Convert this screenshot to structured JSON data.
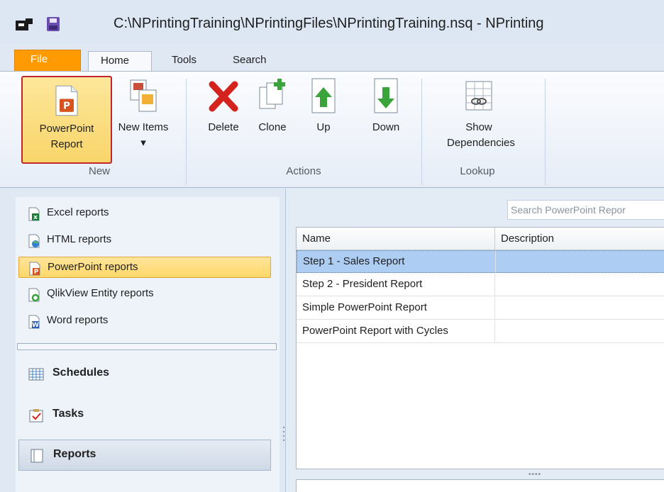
{
  "window": {
    "title": "C:\\NPrintingTraining\\NPrintingFiles\\NPrintingTraining.nsq - NPrinting"
  },
  "ribbon_tabs": [
    {
      "label": "File"
    },
    {
      "label": "Home"
    },
    {
      "label": "Tools"
    },
    {
      "label": "Search"
    }
  ],
  "ribbon": {
    "powerpoint_report": "PowerPoint Report",
    "new_items": "New Items ▾",
    "delete": "Delete",
    "clone": "Clone",
    "up": "Up",
    "down": "Down",
    "show_dependencies": "Show Dependencies",
    "groups": {
      "new": "New",
      "actions": "Actions",
      "lookup": "Lookup"
    }
  },
  "nav": {
    "reports": [
      {
        "label": "Excel reports",
        "icon": "excel-icon"
      },
      {
        "label": "HTML reports",
        "icon": "html-icon"
      },
      {
        "label": "PowerPoint reports",
        "icon": "powerpoint-icon",
        "selected": true
      },
      {
        "label": "QlikView Entity reports",
        "icon": "qlikview-icon"
      },
      {
        "label": "Word reports",
        "icon": "word-icon"
      }
    ],
    "sections": [
      {
        "label": "Schedules",
        "icon": "schedules-icon"
      },
      {
        "label": "Tasks",
        "icon": "tasks-icon"
      },
      {
        "label": "Reports",
        "icon": "reports-icon",
        "active": true
      }
    ]
  },
  "main": {
    "search_placeholder": "Search PowerPoint Repor",
    "columns": [
      "Name",
      "Description"
    ],
    "rows": [
      {
        "name": "Step 1 - Sales Report",
        "description": "",
        "selected": true
      },
      {
        "name": "Step 2 - President Report",
        "description": ""
      },
      {
        "name": "Simple PowerPoint Report",
        "description": ""
      },
      {
        "name": "PowerPoint Report with Cycles",
        "description": ""
      }
    ]
  },
  "colors": {
    "file_tab": "#ff9b00",
    "selection_highlight": "#ffd86a",
    "row_selected": "#aecdf2",
    "delete_red": "#d4231c",
    "arrow_green": "#3aa33a"
  }
}
